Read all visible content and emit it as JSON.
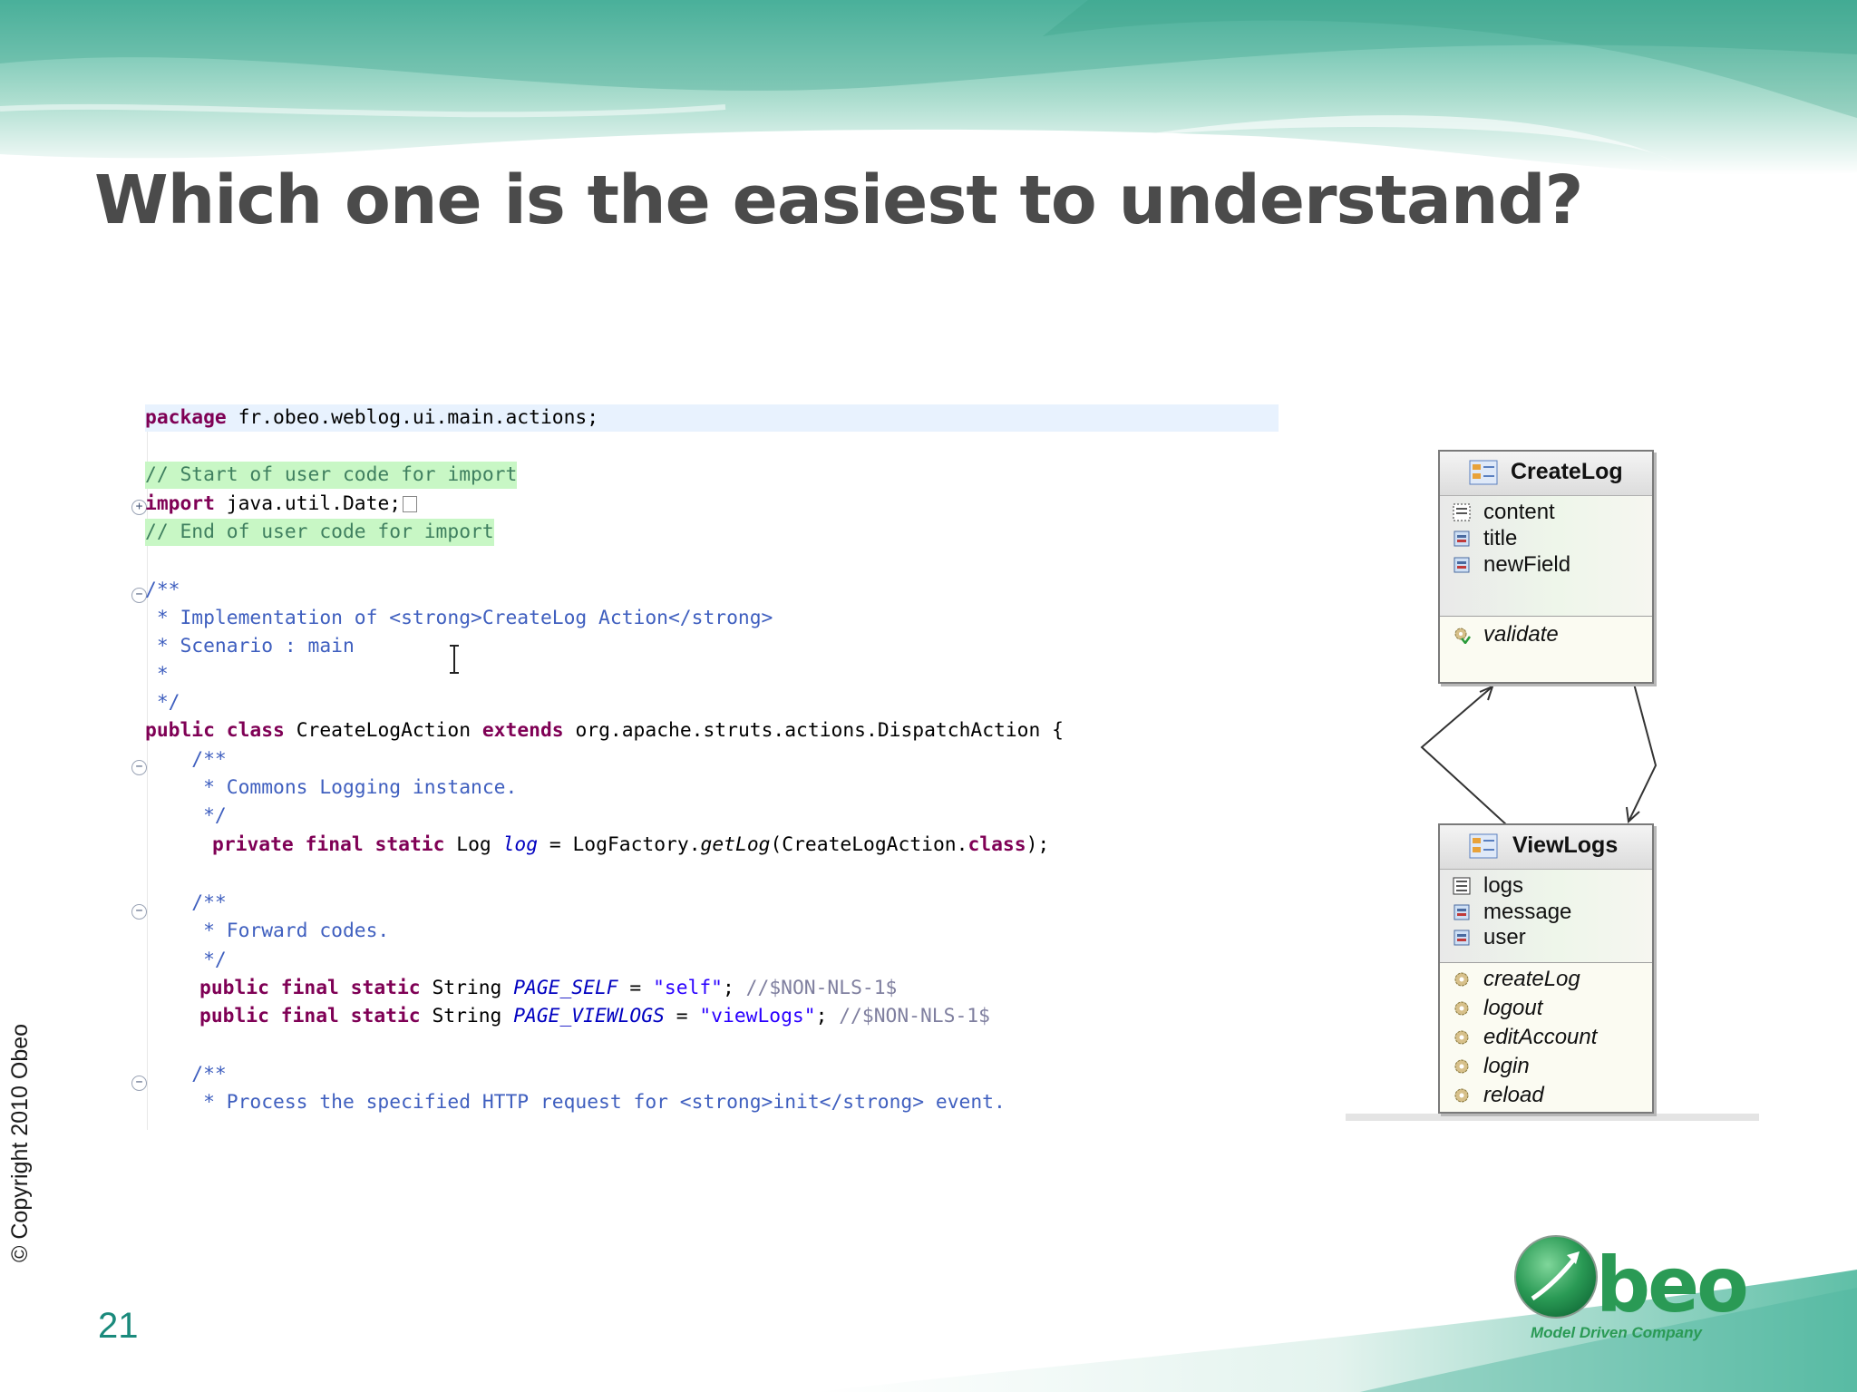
{
  "slide": {
    "title": "Which one is the easiest to understand?",
    "copyright": "© Copyright 2010 Obeo",
    "page_number": "21"
  },
  "code": {
    "package_kw": "package",
    "package_name": " fr.obeo.weblog.ui.main.actions;",
    "import_start": "// Start of user code for import",
    "import_kw": "import",
    "import_rest": " java.util.Date;",
    "import_end": "// End of user code for import",
    "doc_open": "/**",
    "doc_impl": " * Implementation of <strong>CreateLog Action</strong>",
    "doc_scenario": " * Scenario : main",
    "doc_star": " *",
    "doc_close": " */",
    "class_public": "public",
    "class_kw": "class",
    "class_name": " CreateLogAction ",
    "class_extends": "extends",
    "class_super": " org.apache.struts.actions.DispatchAction {",
    "d2_open": "    /**",
    "d2_text": "     * Commons Logging instance.",
    "d2_close": "     */",
    "log_kws": "private final static",
    "log_type": " Log ",
    "log_field": "log",
    "log_mid": " = LogFactory.",
    "log_call": "getLog",
    "log_arg": "(CreateLogAction.",
    "log_class_kw": "class",
    "log_end": ");",
    "d3_open": "    /**",
    "d3_text": "     * Forward codes.",
    "d3_close": "     */",
    "f1_kws": "public final static",
    "f1_type": " String ",
    "f1_name": "PAGE_SELF",
    "f1_eq": " = ",
    "f1_val": "\"self\"",
    "f1_semi": "; ",
    "f1_nls": "//$NON-NLS-1$",
    "f2_kws": "public final static",
    "f2_type": " String ",
    "f2_name": "PAGE_VIEWLOGS",
    "f2_eq": " = ",
    "f2_val": "\"viewLogs\"",
    "f2_semi": "; ",
    "f2_nls": "//$NON-NLS-1$",
    "d4_open": "    /**",
    "d4_text": "     * Process the specified HTTP request for <strong>init</strong> event."
  },
  "diagram": {
    "classes": [
      {
        "name": "CreateLog",
        "attributes": [
          "content",
          "title",
          "newField"
        ],
        "operations": [
          "validate"
        ]
      },
      {
        "name": "ViewLogs",
        "attributes": [
          "logs",
          "message",
          "user"
        ],
        "operations": [
          "createLog",
          "logout",
          "editAccount",
          "login",
          "reload"
        ]
      }
    ]
  },
  "logo": {
    "wordmark": "beo",
    "tagline": "Model Driven Company"
  }
}
